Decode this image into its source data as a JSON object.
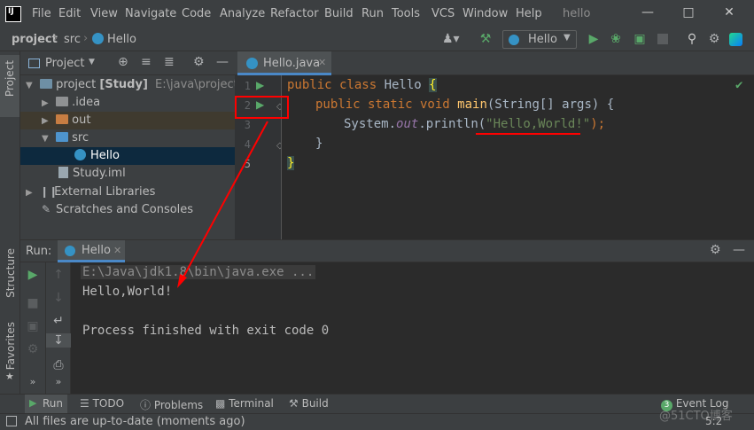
{
  "titlebar": {
    "logo": "IJ",
    "menus": [
      "File",
      "Edit",
      "View",
      "Navigate",
      "Code",
      "Analyze",
      "Refactor",
      "Build",
      "Run",
      "Tools",
      "VCS",
      "Window",
      "Help"
    ],
    "title": "hello"
  },
  "navbar": {
    "breadcrumbs": [
      "project",
      "src",
      "Hello"
    ],
    "run_config": "Hello"
  },
  "left_strip": {
    "project_tab": "Project",
    "structure_tab": "Structure",
    "favorites_tab": "Favorites"
  },
  "project_panel": {
    "header_label": "Project",
    "tree": [
      {
        "label": "project",
        "bold_suffix": "[Study]",
        "path": "E:\\java\\project"
      },
      {
        "label": ".idea"
      },
      {
        "label": "out"
      },
      {
        "label": "src"
      },
      {
        "label": "Hello"
      },
      {
        "label": "Study.iml"
      },
      {
        "label": "External Libraries"
      },
      {
        "label": "Scratches and Consoles"
      }
    ]
  },
  "editor": {
    "tab_label": "Hello.java",
    "line_numbers": [
      "1",
      "2",
      "3",
      "4",
      "5"
    ],
    "code": {
      "l1_kw": "public class ",
      "l1_name": "Hello ",
      "l1_brace": "{",
      "l2_kw": "public static void ",
      "l2_fn": "main",
      "l2_rest": "(String[] args) {",
      "l3_a": "System.",
      "l3_out": "out",
      "l3_b": ".println(",
      "l3_str": "\"Hello,World!\"",
      "l3_c": ");",
      "l4": "}",
      "l5": "}"
    }
  },
  "run_panel": {
    "label": "Run:",
    "tab_label": "Hello",
    "console": [
      "E:\\Java\\jdk1.8\\bin\\java.exe ...",
      "Hello,World!",
      "",
      "Process finished with exit code 0"
    ]
  },
  "bottom_tabs": {
    "run": "Run",
    "todo": "TODO",
    "problems": "Problems",
    "terminal": "Terminal",
    "build": "Build",
    "event_log": "Event Log",
    "event_count": "3"
  },
  "status": {
    "message": "All files are up-to-date (moments ago)",
    "position": "5:2",
    "watermark": "@51CTO博客"
  },
  "colors": {
    "accent": "#4a88c7",
    "run_green": "#59a869",
    "annotation_red": "#ff0000"
  }
}
